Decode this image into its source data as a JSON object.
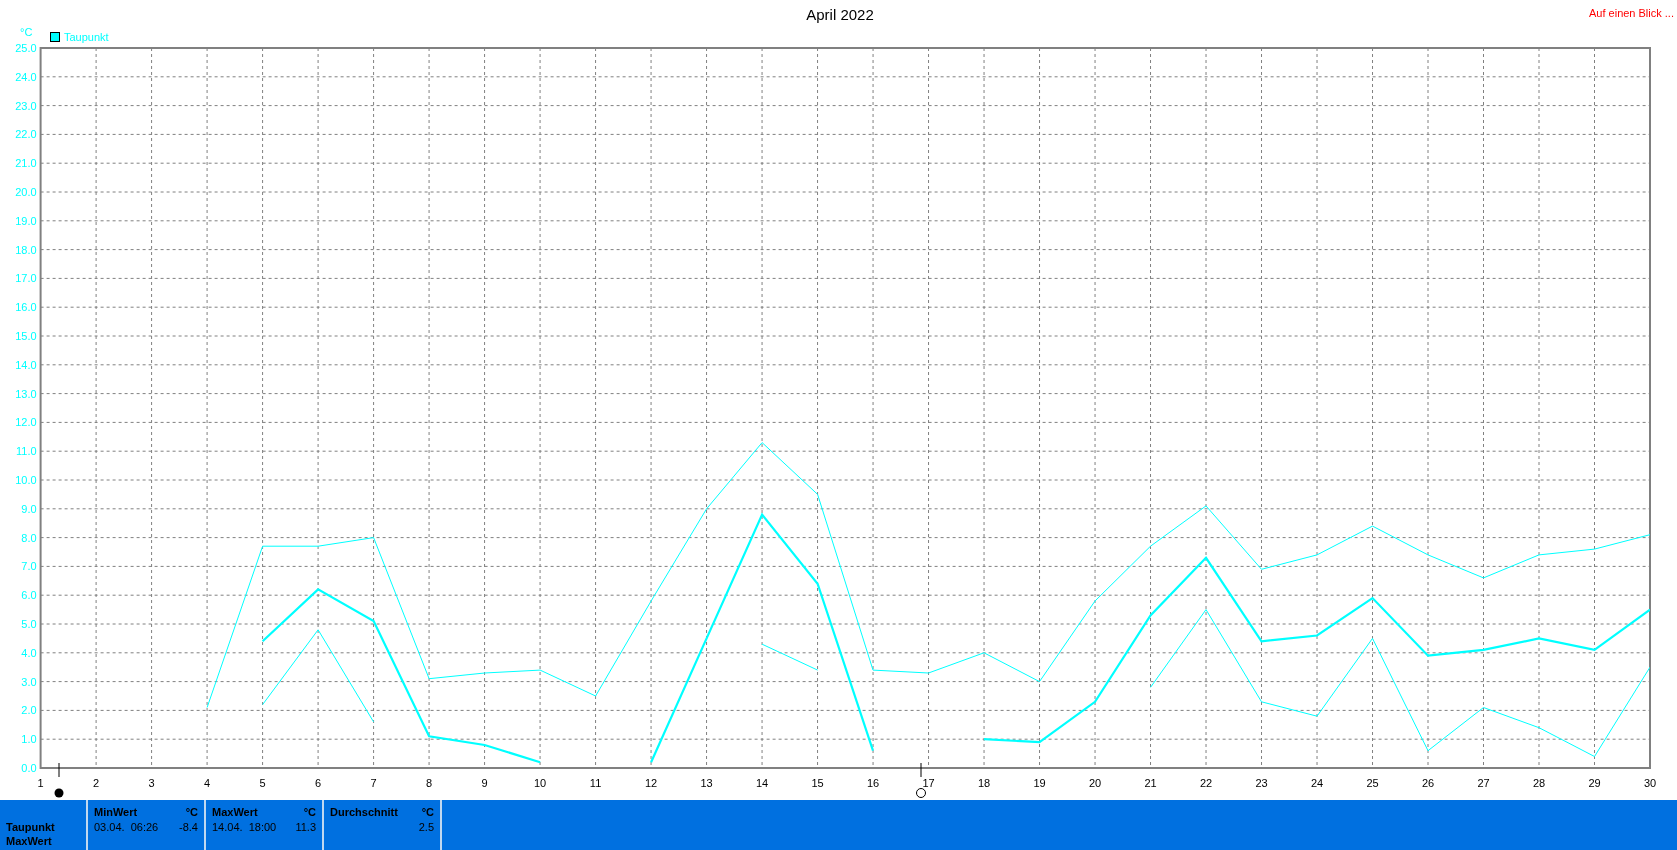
{
  "title": "April 2022",
  "top_link": "Auf einen Blick ...",
  "legend": {
    "label": "Taupunkt",
    "color": "#00ffff"
  },
  "chart_data": {
    "type": "line",
    "ylabel": "°C",
    "grid": true,
    "x": [
      1,
      2,
      3,
      4,
      5,
      6,
      7,
      8,
      9,
      10,
      11,
      12,
      13,
      14,
      15,
      16,
      17,
      18,
      19,
      20,
      21,
      22,
      23,
      24,
      25,
      26,
      27,
      28,
      29,
      30
    ],
    "series": [
      {
        "color": "#00ffff",
        "values": [
          null,
          null,
          null,
          2.1,
          7.7,
          7.7,
          8.0,
          3.1,
          3.3,
          3.4,
          2.5,
          5.8,
          9.0,
          11.3,
          9.5,
          3.4,
          3.3,
          4.0,
          3.0,
          5.8,
          7.7,
          9.1,
          6.9,
          7.4,
          8.4,
          7.4,
          6.6,
          7.4,
          7.6,
          8.1
        ]
      },
      {
        "color": "#00ffff",
        "values": [
          null,
          null,
          null,
          null,
          4.4,
          6.2,
          5.1,
          1.1,
          0.8,
          0.2,
          null,
          0.2,
          4.5,
          8.8,
          6.4,
          0.6,
          null,
          1.0,
          0.9,
          2.3,
          5.3,
          7.3,
          4.4,
          4.6,
          5.9,
          3.9,
          4.1,
          4.5,
          4.1,
          5.5
        ]
      },
      {
        "color": "#00ffff",
        "values": [
          null,
          null,
          null,
          null,
          2.2,
          4.8,
          1.6,
          null,
          null,
          null,
          null,
          null,
          null,
          4.3,
          3.4,
          null,
          null,
          null,
          null,
          null,
          2.8,
          5.5,
          2.3,
          1.8,
          4.5,
          0.6,
          2.1,
          1.4,
          0.4,
          3.5
        ]
      }
    ],
    "ylim": [
      0,
      25
    ],
    "yticks": [
      {
        "value": 0,
        "label": "0.0"
      },
      {
        "value": 1,
        "label": "1.0"
      },
      {
        "value": 2,
        "label": "2.0"
      },
      {
        "value": 3,
        "label": "3.0"
      },
      {
        "value": 4,
        "label": "4.0"
      },
      {
        "value": 5,
        "label": "5.0"
      },
      {
        "value": 6,
        "label": "6.0"
      },
      {
        "value": 7,
        "label": "7.0"
      },
      {
        "value": 8,
        "label": "8.0"
      },
      {
        "value": 9,
        "label": "9.0"
      },
      {
        "value": 10,
        "label": "10.0"
      },
      {
        "value": 11,
        "label": "11.0"
      },
      {
        "value": 12,
        "label": "12.0"
      },
      {
        "value": 13,
        "label": "13.0"
      },
      {
        "value": 14,
        "label": "14.0"
      },
      {
        "value": 15,
        "label": "15.0"
      },
      {
        "value": 16,
        "label": "16.0"
      },
      {
        "value": 17,
        "label": "17.0"
      },
      {
        "value": 18,
        "label": "18.0"
      },
      {
        "value": 19,
        "label": "19.0"
      },
      {
        "value": 20,
        "label": "20.0"
      },
      {
        "value": 21,
        "label": "21.0"
      },
      {
        "value": 22,
        "label": "22.0"
      },
      {
        "value": 23,
        "label": "23.0"
      },
      {
        "value": 24,
        "label": "24.0"
      },
      {
        "value": 25,
        "label": "25.0"
      }
    ]
  },
  "summary": {
    "row_labels": [
      "Taupunkt",
      "MaxWert"
    ],
    "columns": [
      {
        "header": "MinWert",
        "unit": "°C",
        "date": "03.04.",
        "time": "06:26",
        "value": "-8.4"
      },
      {
        "header": "MaxWert",
        "unit": "°C",
        "date": "14.04.",
        "time": "18:00",
        "value": "11.3"
      },
      {
        "header": "Durchschnitt",
        "unit": "°C",
        "value": "2.5"
      }
    ]
  }
}
